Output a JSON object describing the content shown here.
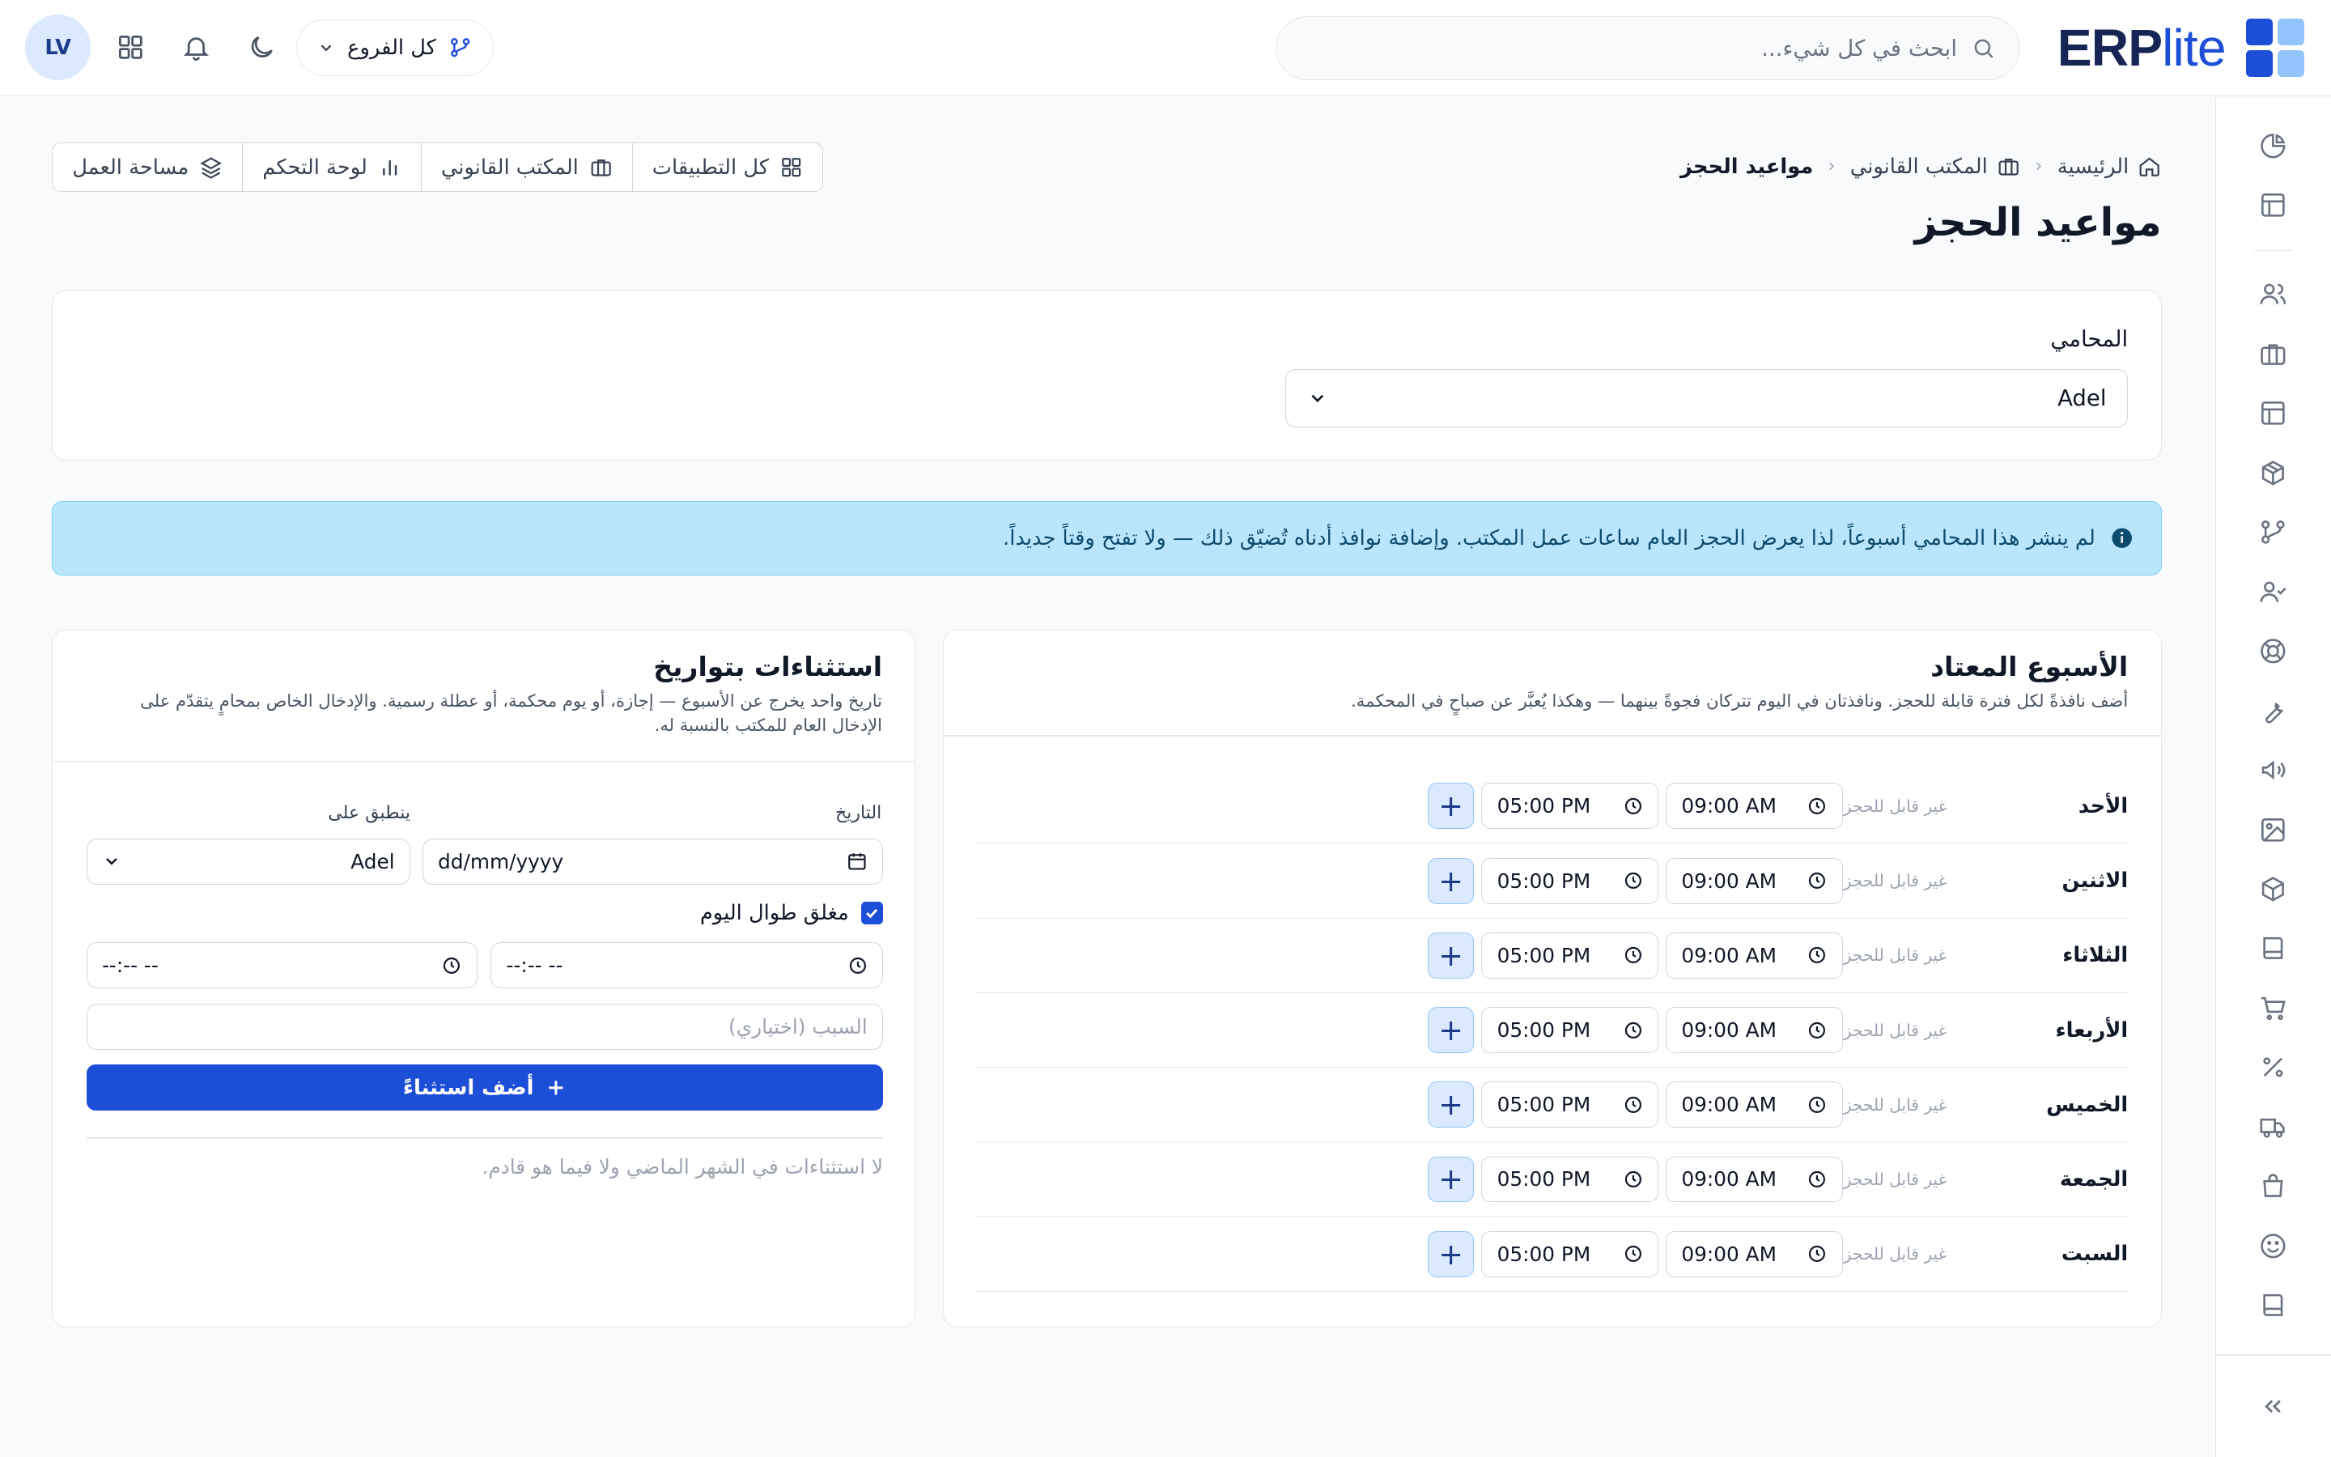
{
  "app": {
    "logo_text": "ERP",
    "logo_suffix": "lite",
    "search_placeholder": "ابحث في كل شيء...",
    "branch_label": "كل الفروع",
    "user_initials": "LV"
  },
  "breadcrumb": {
    "home": "الرئيسية",
    "section": "المكتب القانوني",
    "current": "مواعيد الحجز"
  },
  "quick_links": {
    "all_apps": "كل التطبيقات",
    "legal_office": "المكتب القانوني",
    "dashboard": "لوحة التحكم",
    "workspace": "مساحة العمل"
  },
  "page_title": "مواعيد الحجز",
  "lawyer": {
    "label": "المحامي",
    "value": "Adel"
  },
  "notice": "لم ينشر هذا المحامي أسبوعاً، لذا يعرض الحجز العام ساعات عمل المكتب. وإضافة نوافذ أدناه تُضيّق ذلك — ولا تفتح وقتاً جديداً.",
  "weekly": {
    "title": "الأسبوع المعتاد",
    "subtitle": "أضف نافذةً لكل فترة قابلة للحجز. ونافذتان في اليوم تتركان فجوةً بينهما — وهكذا يُعبَّر عن صباحٍ في المحكمة.",
    "not_bookable": "غير قابل للحجز",
    "days": [
      {
        "name": "الأحد",
        "start": "09:00 AM",
        "end": "05:00 PM"
      },
      {
        "name": "الاثنين",
        "start": "09:00 AM",
        "end": "05:00 PM"
      },
      {
        "name": "الثلاثاء",
        "start": "09:00 AM",
        "end": "05:00 PM"
      },
      {
        "name": "الأربعاء",
        "start": "09:00 AM",
        "end": "05:00 PM"
      },
      {
        "name": "الخميس",
        "start": "09:00 AM",
        "end": "05:00 PM"
      },
      {
        "name": "الجمعة",
        "start": "09:00 AM",
        "end": "05:00 PM"
      },
      {
        "name": "السبت",
        "start": "09:00 AM",
        "end": "05:00 PM"
      }
    ]
  },
  "exceptions": {
    "title": "استثناءات بتواريخ",
    "subtitle": "تاريخ واحد يخرج عن الأسبوع — إجازة، أو يوم محكمة، أو عطلة رسمية. والإدخال الخاص بمحامٍ يتقدّم على الإدخال العام للمكتب بالنسبة له.",
    "date_label": "التاريخ",
    "date_placeholder": "dd/mm/yyyy",
    "applies_label": "ينطبق على",
    "applies_value": "Adel",
    "closed_label": "مغلق طوال اليوم",
    "time_start_placeholder": "--:-- --",
    "time_end_placeholder": "--:-- --",
    "reason_placeholder": "السبب (اختياري)",
    "add_button": "أضف استثناءً",
    "empty_text": "لا استثناءات في الشهر الماضي ولا فيما هو قادم."
  }
}
